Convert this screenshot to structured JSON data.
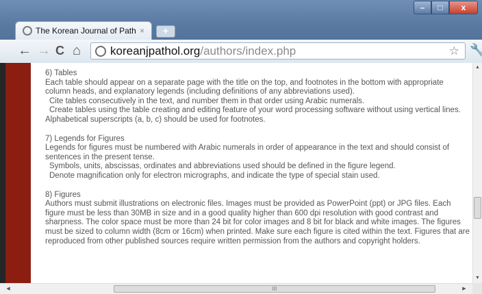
{
  "window": {
    "tab_title": "The Korean Journal of Path",
    "tab_close": "×",
    "new_tab": "+",
    "min_label": "–",
    "max_label": "□",
    "close_label": "x"
  },
  "toolbar": {
    "back": "←",
    "forward": "→",
    "reload": "C",
    "home": "⌂",
    "url_domain": "koreanjpathol.org",
    "url_path": "/authors/index.php",
    "star": "☆",
    "wrench": "🔧"
  },
  "content": {
    "tables_title": "6) Tables",
    "tables_p1": "Each table should appear on a separate page with the title on the top, and footnotes in the bottom with appropriate column heads, and explanatory legends (including definitions of any abbreviations used).",
    "tables_p2": "Cite tables consecutively in the text, and number them in that order using Arabic numerals.",
    "tables_p3": "Create tables using the table creating and editing feature of your word processing software without using vertical lines. Alphabetical superscripts (a, b, c) should be used for footnotes.",
    "legends_title": "7) Legends for Figures",
    "legends_p1": "Legends for figures must be numbered with Arabic numerals in order of appearance in the text and should consist of sentences in the present tense.",
    "legends_p2": "Symbols, units, abscissas, ordinates and abbreviations used should be defined in the figure legend.",
    "legends_p3": "Denote magnification only for electron micrographs, and indicate the type of special stain used.",
    "figures_title": "8) Figures",
    "figures_p1": "Authors must submit illustrations on electronic files. Images must be provided as PowerPoint (ppt) or JPG files. Each figure must be less than 30MB in size and in a good quality higher than 600 dpi resolution with good contrast and sharpness. The color space must be more than 24 bit for color images and 8 bit for black and white images. The figures must be sized to column width (8cm or 16cm) when printed. Make sure each figure is cited within the text. Figures that are reproduced from other published sources require written permission from the authors and copyright holders."
  },
  "scrollbar": {
    "h_thumb_grip": "III",
    "v_thumb_grip": "≡"
  }
}
